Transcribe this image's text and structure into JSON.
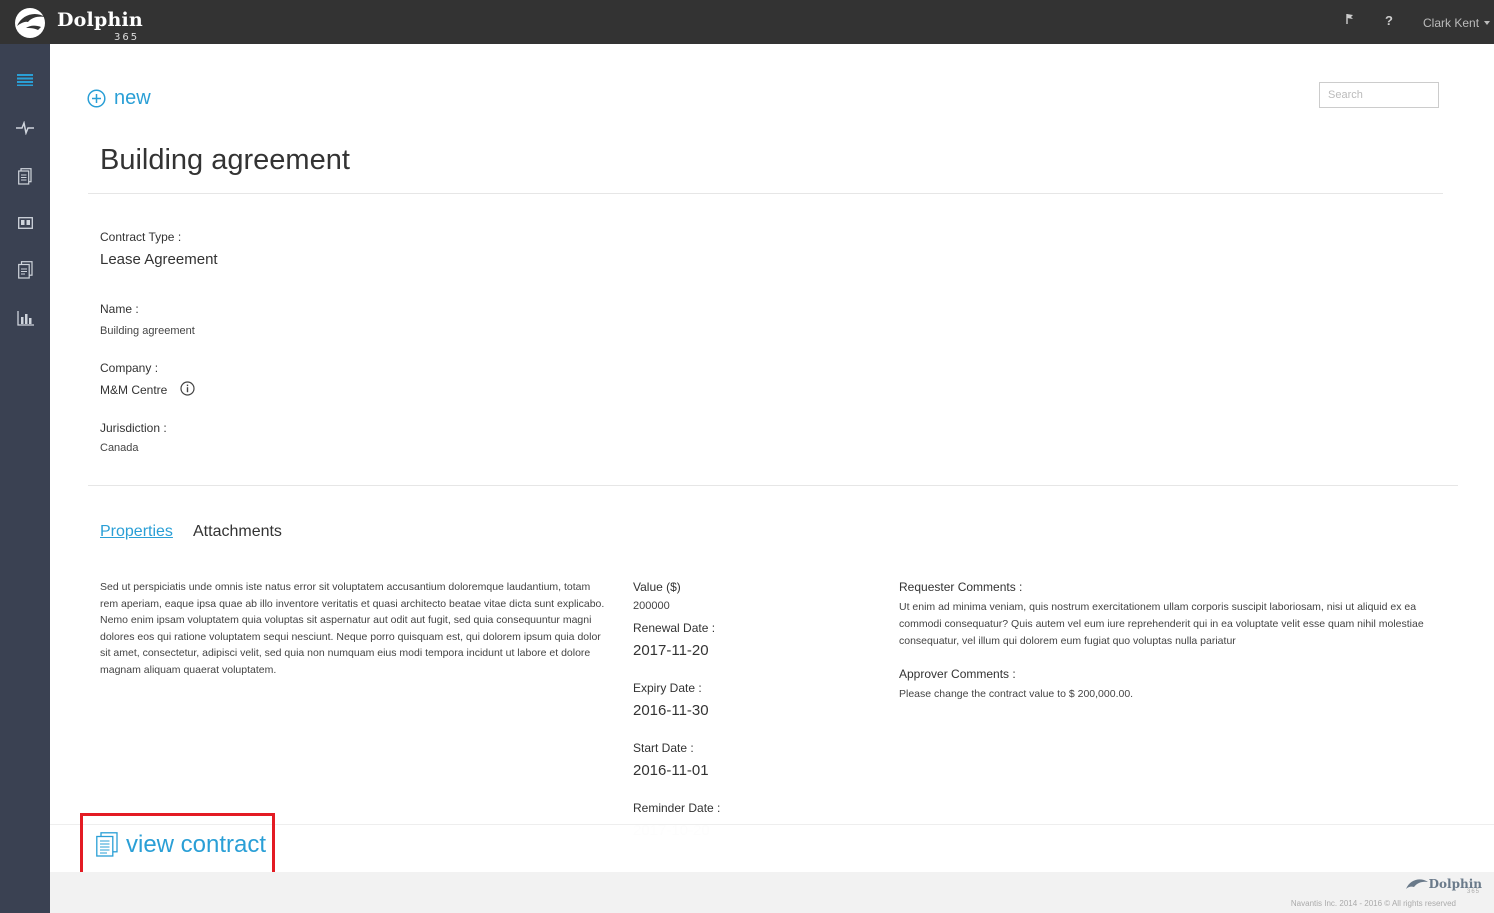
{
  "app": {
    "brand": "Dolphin",
    "brand_sub": "365",
    "user_name": "Clark Kent"
  },
  "sidebar": {
    "items": [
      {
        "icon": "list-icon"
      },
      {
        "icon": "pulse-icon"
      },
      {
        "icon": "document-icon"
      },
      {
        "icon": "board-icon"
      },
      {
        "icon": "report-icon"
      },
      {
        "icon": "bar-chart-icon"
      }
    ],
    "accent": "#2a9fd6"
  },
  "toolbar": {
    "new_label": "new",
    "search_placeholder": "Search"
  },
  "contract": {
    "title": "Building agreement",
    "type_label": "Contract Type :",
    "type_value": "Lease Agreement",
    "name_label": "Name :",
    "name_value": "Building agreement",
    "company_label": "Company :",
    "company_value": "M&M Centre",
    "jurisdiction_label": "Jurisdiction :",
    "jurisdiction_value": "Canada"
  },
  "tabs": {
    "properties": "Properties",
    "attachments": "Attachments"
  },
  "properties": {
    "description": "Sed ut perspiciatis unde omnis iste natus error sit voluptatem accusantium doloremque laudantium, totam rem aperiam, eaque ipsa quae ab illo inventore veritatis et quasi architecto beatae vitae dicta sunt explicabo. Nemo enim ipsam voluptatem quia voluptas sit aspernatur aut odit aut fugit, sed quia consequuntur magni dolores eos qui ratione voluptatem sequi nesciunt. Neque porro quisquam est, qui dolorem ipsum quia dolor sit amet, consectetur, adipisci velit, sed quia non numquam eius modi tempora incidunt ut labore et dolore magnam aliquam quaerat voluptatem.",
    "value_label": "Value ($)",
    "value": "200000",
    "renewal_label": "Renewal Date :",
    "renewal_date": "2017-11-20",
    "expiry_label": "Expiry Date :",
    "expiry_date": "2016-11-30",
    "start_label": "Start Date :",
    "start_date": "2016-11-01",
    "reminder_label": "Reminder Date :",
    "reminder_date": "2017-10-20",
    "requester_label": "Requester Comments :",
    "requester_comments": "Ut enim ad minima veniam, quis nostrum exercitationem ullam corporis suscipit laboriosam, nisi ut aliquid ex ea commodi consequatur? Quis autem vel eum iure reprehenderit qui in ea voluptate velit esse quam nihil molestiae consequatur, vel illum qui dolorem eum fugiat quo voluptas nulla pariatur",
    "approver_label": "Approver Comments :",
    "approver_comments": "Please change the contract value to $ 200,000.00."
  },
  "bottom": {
    "view_contract_label": "view contract",
    "highlight_color": "#e31b23"
  },
  "footer": {
    "brand": "Dolphin",
    "brand_sub": "365",
    "copyright": "Navantis Inc. 2014 - 2016 © All rights reserved"
  }
}
